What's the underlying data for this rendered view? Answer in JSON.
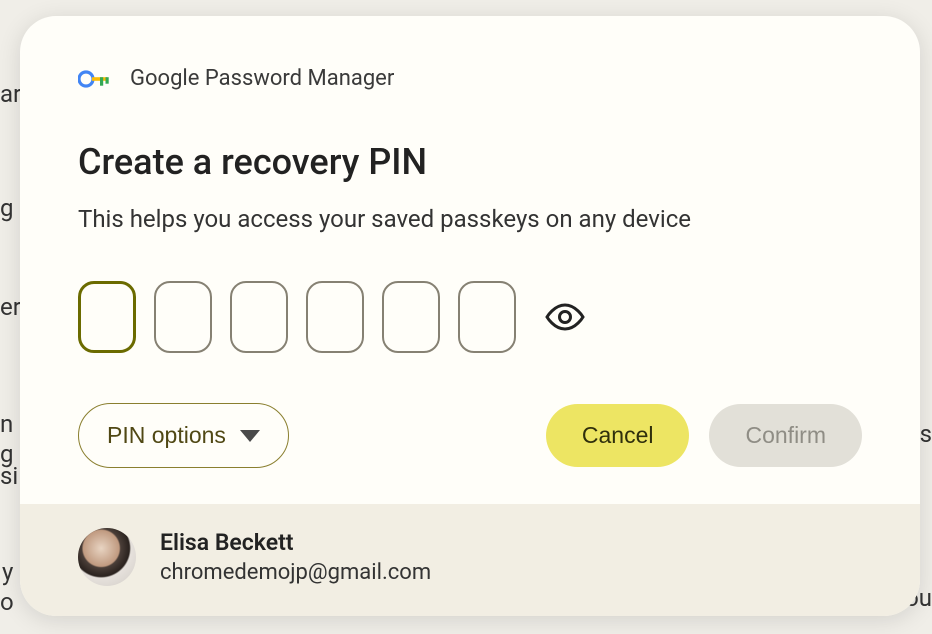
{
  "brand": {
    "label": "Google Password Manager"
  },
  "dialog": {
    "title": "Create a recovery PIN",
    "subtitle": "This helps you access your saved passkeys on any device",
    "pin_options_label": "PIN options",
    "cancel_label": "Cancel",
    "confirm_label": "Confirm"
  },
  "account": {
    "name": "Elisa Beckett",
    "email": "chromedemojp@gmail.com"
  },
  "pin": {
    "length": 6,
    "focused_index": 0
  }
}
